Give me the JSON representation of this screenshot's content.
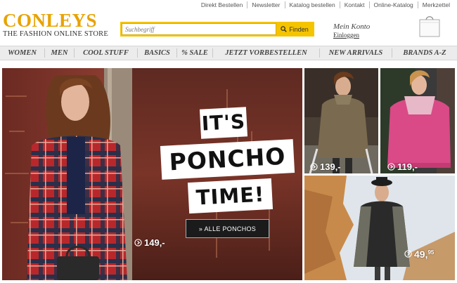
{
  "top_links": [
    "Direkt Bestellen",
    "Newsletter",
    "Katalog bestellen",
    "Kontakt",
    "Online-Katalog",
    "Merkzettel"
  ],
  "logo": {
    "name": "CONLEYS",
    "tagline": "THE FASHION ONLINE STORE"
  },
  "search": {
    "placeholder": "Suchbegriff",
    "button_label": "Finden"
  },
  "account": {
    "title": "Mein Konto",
    "login_label": "Einloggen"
  },
  "nav": [
    "WOMEN",
    "MEN",
    "COOL STUFF",
    "BASICS",
    "% SALE",
    "JETZT VORBESTELLEN",
    "NEW ARRIVALS",
    "BRANDS A-Z"
  ],
  "hero": {
    "headline_1": "IT'S",
    "headline_2": "PONCHO",
    "headline_3": "TIME!",
    "cta_label": "» ALLE PONCHOS",
    "price": "149,-"
  },
  "tiles": [
    {
      "price": "139,-"
    },
    {
      "price": "119,-"
    },
    {
      "price": "49,",
      "price_cents": "95"
    }
  ],
  "colors": {
    "brand": "#e8a200",
    "search_bar": "#f5c400",
    "nav_bg": "#ececec"
  },
  "icons": [
    "search-icon",
    "shopping-bag-icon",
    "play-circle-icon"
  ]
}
